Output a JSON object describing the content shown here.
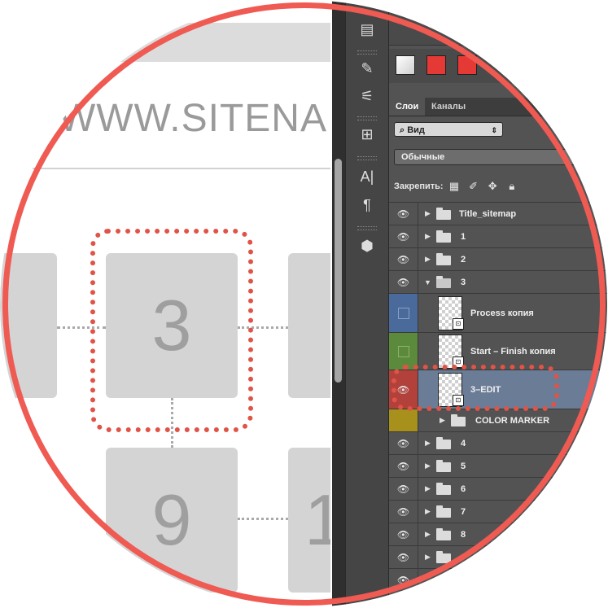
{
  "canvas": {
    "site_title": "WWW.SITENA",
    "tiles": [
      {
        "label": ""
      },
      {
        "label": "3"
      },
      {
        "label": ""
      },
      {
        "label": "9"
      },
      {
        "label": "1"
      }
    ]
  },
  "panel": {
    "tabs": [
      {
        "label": "Слои",
        "active": true
      },
      {
        "label": "Каналы",
        "active": false
      }
    ],
    "filter_label": "Вид",
    "blend_mode": "Обычные",
    "lock_label": "Закрепить:",
    "swatch_colors": [
      "#cfcfcf",
      "#e53935",
      "#e53935"
    ],
    "layers": [
      {
        "name": "Title_sitemap",
        "type": "group",
        "expanded": false,
        "color": ""
      },
      {
        "name": "1",
        "type": "group",
        "expanded": false,
        "color": ""
      },
      {
        "name": "2",
        "type": "group",
        "expanded": false,
        "color": ""
      },
      {
        "name": "3",
        "type": "group",
        "expanded": true,
        "color": ""
      },
      {
        "name": "Process копия",
        "type": "smart",
        "color": "#4a6a9c"
      },
      {
        "name": "Start – Finish копия",
        "type": "smart",
        "color": "#5c8a3c"
      },
      {
        "name": "3–EDIT",
        "type": "smart",
        "color": "#b2413b",
        "selected": true
      },
      {
        "name": "COLOR MARKER",
        "type": "group",
        "expanded": false,
        "color": "#a8901c"
      },
      {
        "name": "4",
        "type": "group",
        "expanded": false,
        "color": ""
      },
      {
        "name": "5",
        "type": "group",
        "expanded": false,
        "color": ""
      },
      {
        "name": "6",
        "type": "group",
        "expanded": false,
        "color": ""
      },
      {
        "name": "7",
        "type": "group",
        "expanded": false,
        "color": ""
      },
      {
        "name": "8",
        "type": "group",
        "expanded": false,
        "color": ""
      }
    ]
  },
  "colors": {
    "accent_ring": "#ef5a52",
    "selection_dots": "#e05346",
    "selected_layer_bg": "#6a7c96",
    "panel_bg": "#535353"
  }
}
